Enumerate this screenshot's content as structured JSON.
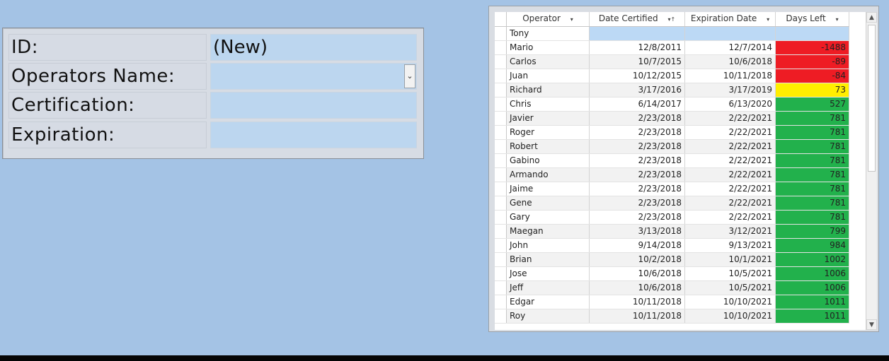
{
  "form": {
    "fields": [
      {
        "label": "ID:",
        "value": "(New)",
        "combo": false
      },
      {
        "label": "Operators Name:",
        "value": "",
        "combo": true
      },
      {
        "label": "Certification:",
        "value": "",
        "combo": false
      },
      {
        "label": "Expiration:",
        "value": "",
        "combo": false
      }
    ]
  },
  "sheet": {
    "columns": [
      "Operator",
      "Date Certified",
      "Expiration Date",
      "Days Left"
    ],
    "sort_glyphs": [
      "▾",
      "▾↑",
      "▾",
      "▾"
    ],
    "rows": [
      {
        "operator": "Tony",
        "certified": "",
        "expiration": "",
        "days": "",
        "status": "new"
      },
      {
        "operator": "Mario",
        "certified": "12/8/2011",
        "expiration": "12/7/2014",
        "days": "-1488",
        "status": "red"
      },
      {
        "operator": "Carlos",
        "certified": "10/7/2015",
        "expiration": "10/6/2018",
        "days": "-89",
        "status": "red"
      },
      {
        "operator": "Juan",
        "certified": "10/12/2015",
        "expiration": "10/11/2018",
        "days": "-84",
        "status": "red"
      },
      {
        "operator": "Richard",
        "certified": "3/17/2016",
        "expiration": "3/17/2019",
        "days": "73",
        "status": "yellow"
      },
      {
        "operator": "Chris",
        "certified": "6/14/2017",
        "expiration": "6/13/2020",
        "days": "527",
        "status": "green"
      },
      {
        "operator": "Javier",
        "certified": "2/23/2018",
        "expiration": "2/22/2021",
        "days": "781",
        "status": "green"
      },
      {
        "operator": "Roger",
        "certified": "2/23/2018",
        "expiration": "2/22/2021",
        "days": "781",
        "status": "green"
      },
      {
        "operator": "Robert",
        "certified": "2/23/2018",
        "expiration": "2/22/2021",
        "days": "781",
        "status": "green"
      },
      {
        "operator": "Gabino",
        "certified": "2/23/2018",
        "expiration": "2/22/2021",
        "days": "781",
        "status": "green"
      },
      {
        "operator": "Armando",
        "certified": "2/23/2018",
        "expiration": "2/22/2021",
        "days": "781",
        "status": "green"
      },
      {
        "operator": "Jaime",
        "certified": "2/23/2018",
        "expiration": "2/22/2021",
        "days": "781",
        "status": "green"
      },
      {
        "operator": "Gene",
        "certified": "2/23/2018",
        "expiration": "2/22/2021",
        "days": "781",
        "status": "green"
      },
      {
        "operator": "Gary",
        "certified": "2/23/2018",
        "expiration": "2/22/2021",
        "days": "781",
        "status": "green"
      },
      {
        "operator": "Maegan",
        "certified": "3/13/2018",
        "expiration": "3/12/2021",
        "days": "799",
        "status": "green"
      },
      {
        "operator": "John",
        "certified": "9/14/2018",
        "expiration": "9/13/2021",
        "days": "984",
        "status": "green"
      },
      {
        "operator": "Brian",
        "certified": "10/2/2018",
        "expiration": "10/1/2021",
        "days": "1002",
        "status": "green"
      },
      {
        "operator": "Jose",
        "certified": "10/6/2018",
        "expiration": "10/5/2021",
        "days": "1006",
        "status": "green"
      },
      {
        "operator": "Jeff",
        "certified": "10/6/2018",
        "expiration": "10/5/2021",
        "days": "1006",
        "status": "green"
      },
      {
        "operator": "Edgar",
        "certified": "10/11/2018",
        "expiration": "10/10/2021",
        "days": "1011",
        "status": "green"
      },
      {
        "operator": "Roy",
        "certified": "10/11/2018",
        "expiration": "10/10/2021",
        "days": "1011",
        "status": "green"
      }
    ]
  },
  "colors": {
    "red": "#ee1c24",
    "yellow": "#ffee00",
    "green": "#22b14c",
    "selected": "#bcd9f5"
  }
}
